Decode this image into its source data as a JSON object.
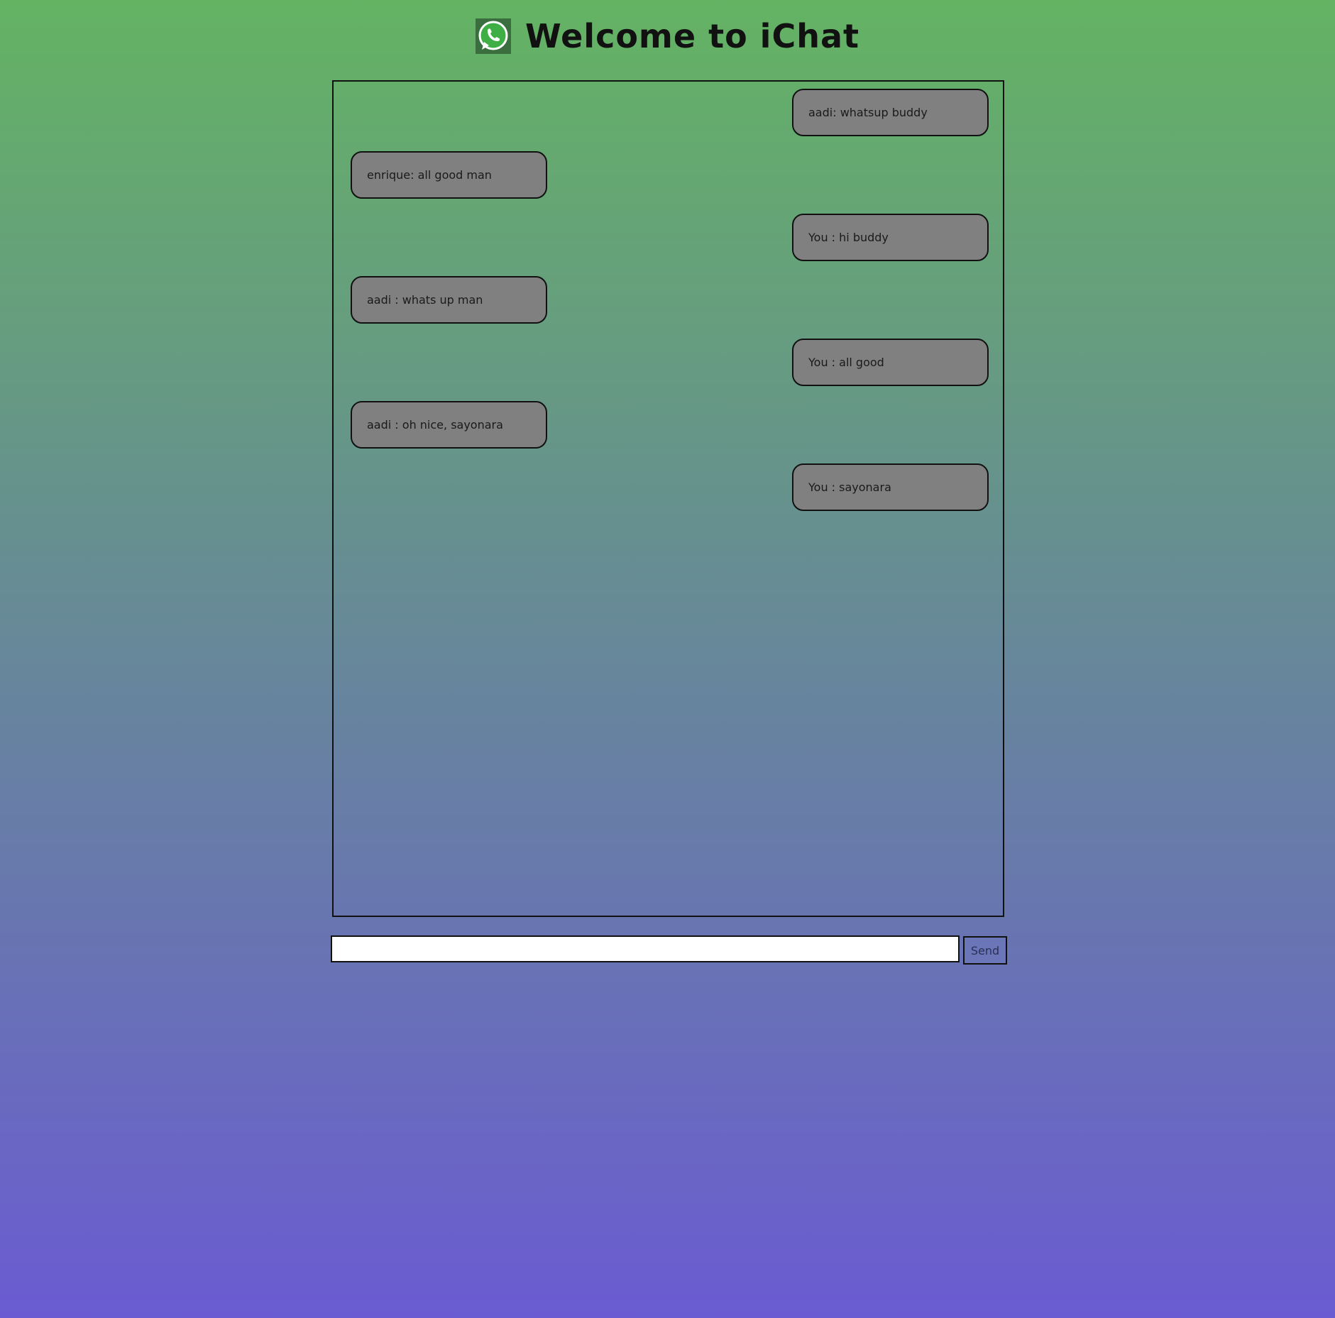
{
  "header": {
    "icon": "whatsapp-phone-icon",
    "title": "Welcome to iChat"
  },
  "messages": [
    {
      "side": "right",
      "text": "aadi: whatsup buddy"
    },
    {
      "side": "left",
      "text": "enrique: all good man"
    },
    {
      "side": "right",
      "text": "You : hi buddy"
    },
    {
      "side": "left",
      "text": "aadi : whats up man"
    },
    {
      "side": "right",
      "text": "You : all good"
    },
    {
      "side": "left",
      "text": "aadi : oh nice, sayonara"
    },
    {
      "side": "right",
      "text": "You : sayonara"
    }
  ],
  "composer": {
    "value": "",
    "send_label": "Send"
  },
  "colors": {
    "gradient_top": "#64b363",
    "gradient_bottom": "#6a5bd2",
    "bubble": "#808080",
    "logo_green": "#3fae44",
    "send_button": "#6a76b8"
  }
}
